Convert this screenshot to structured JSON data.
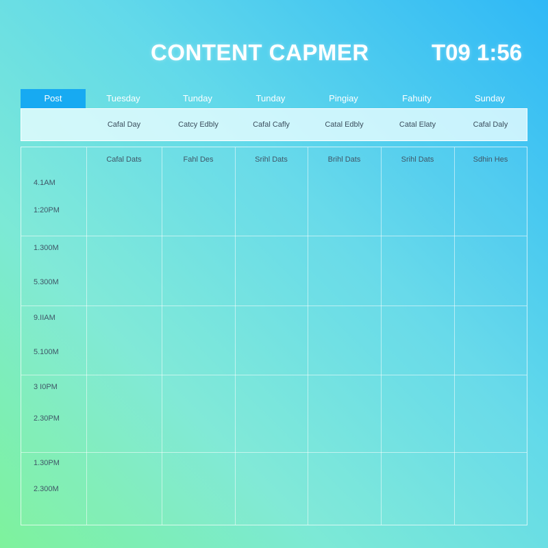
{
  "header": {
    "title": "CONTENT CAPMER",
    "clock": "T09 1:56"
  },
  "tabs": [
    {
      "label": "Post",
      "active": true
    },
    {
      "label": "Tuesday"
    },
    {
      "label": "Tunday"
    },
    {
      "label": "Tunday"
    },
    {
      "label": "Pingiay"
    },
    {
      "label": "Fahuity"
    },
    {
      "label": "Sunday"
    }
  ],
  "sub_labels": [
    "",
    "Cafal Day",
    "Catcy Edbly",
    "Cafal Cafly",
    "Catal Edbly",
    "Catal Elaty",
    "Cafal Daly"
  ],
  "grid": {
    "column_headers": [
      "Cafal Dats",
      "Fahl Des",
      "Srihl Dats",
      "Brihl Dats",
      "Srihl Dats",
      "Sdhin Hes"
    ],
    "time_labels": [
      [
        "4.1AM",
        "1:20PM"
      ],
      [
        "1.300M",
        "5.300M"
      ],
      [
        "9.IIAM",
        "5.100M"
      ],
      [
        "3 I0PM",
        "2.30PM"
      ],
      [
        "1.30PM",
        "2.300M"
      ]
    ]
  },
  "colors": {
    "background_start": "#7ef29c",
    "background_end": "#2fb8f6",
    "active_tab": "#17aaf2",
    "text_dark": "#3f5566"
  }
}
